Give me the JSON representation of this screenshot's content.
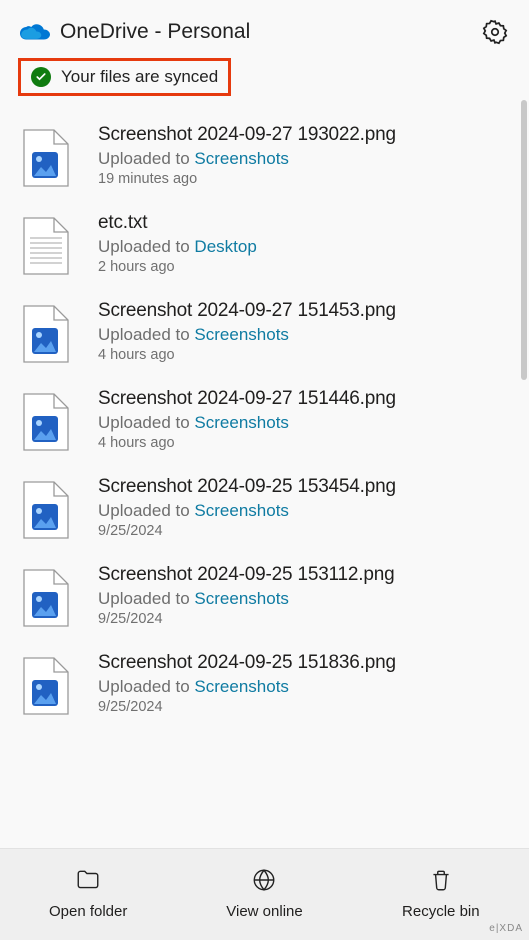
{
  "header": {
    "title": "OneDrive - Personal",
    "settings_icon": "gear-icon"
  },
  "sync": {
    "status_text": "Your files are synced",
    "status_icon": "check-circle-icon",
    "highlight_color": "#e63a0e"
  },
  "upload_prefix": "Uploaded to",
  "files": [
    {
      "name": "Screenshot 2024-09-27 193022.png",
      "location": "Screenshots",
      "time": "19 minutes ago",
      "thumb": "png-image"
    },
    {
      "name": "etc.txt",
      "location": "Desktop",
      "time": "2 hours ago",
      "thumb": "text"
    },
    {
      "name": "Screenshot 2024-09-27 151453.png",
      "location": "Screenshots",
      "time": "4 hours ago",
      "thumb": "png-image"
    },
    {
      "name": "Screenshot 2024-09-27 151446.png",
      "location": "Screenshots",
      "time": "4 hours ago",
      "thumb": "png-image"
    },
    {
      "name": "Screenshot 2024-09-25 153454.png",
      "location": "Screenshots",
      "time": "9/25/2024",
      "thumb": "png-image"
    },
    {
      "name": "Screenshot 2024-09-25 153112.png",
      "location": "Screenshots",
      "time": "9/25/2024",
      "thumb": "png-image"
    },
    {
      "name": "Screenshot 2024-09-25 151836.png",
      "location": "Screenshots",
      "time": "9/25/2024",
      "thumb": "png-image"
    }
  ],
  "footer": {
    "open_folder": "Open folder",
    "view_online": "View online",
    "recycle_bin": "Recycle bin"
  },
  "colors": {
    "link": "#0f7ba2",
    "success": "#107c10",
    "icon_blue": "#1f6bc7"
  },
  "watermark": "e|XDA"
}
